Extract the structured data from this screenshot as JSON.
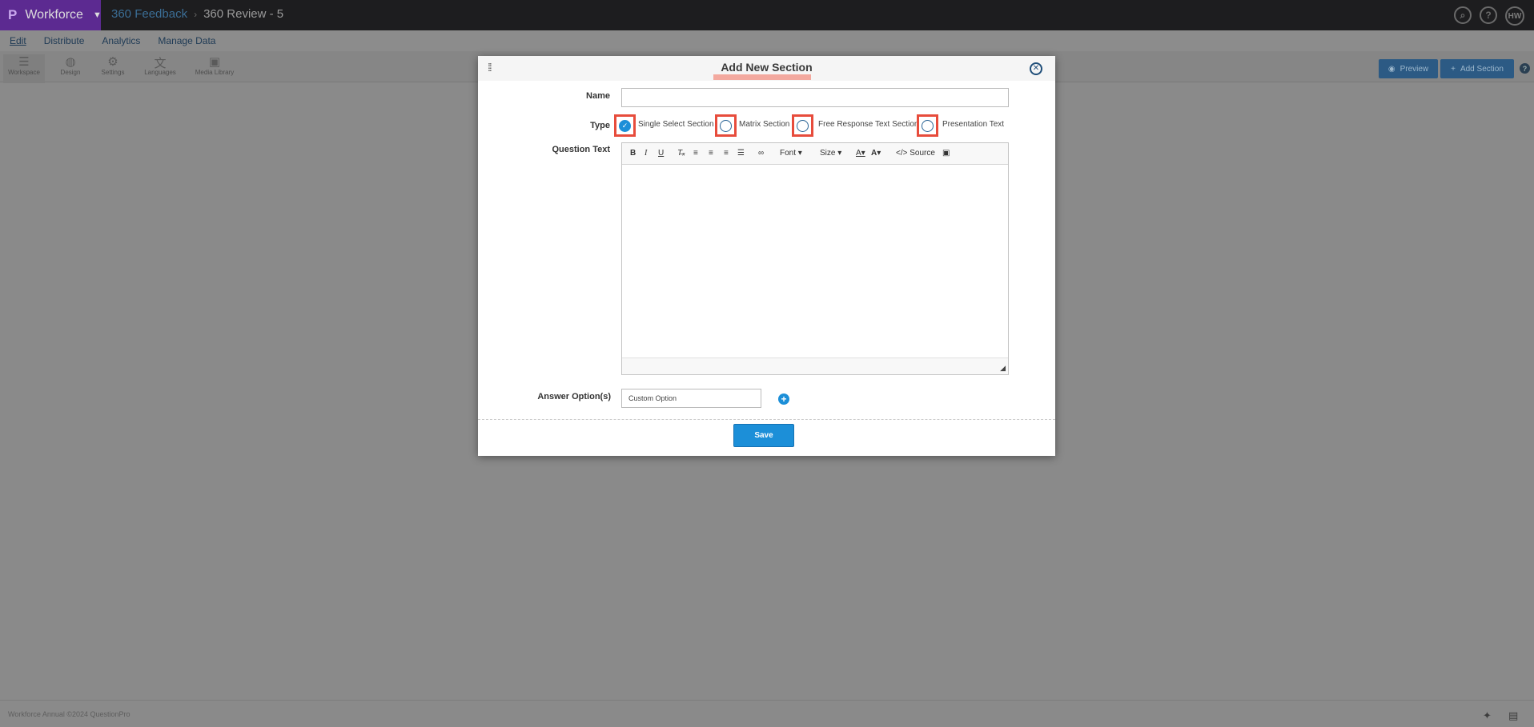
{
  "app": {
    "brand_logo": "P",
    "brand_name": "Workforce",
    "breadcrumb": [
      "360 Feedback",
      "360 Review - 5"
    ],
    "avatar_initials": "HW"
  },
  "menu": {
    "items": [
      "Edit",
      "Distribute",
      "Analytics",
      "Manage Data"
    ],
    "active": "Edit"
  },
  "toolbar": {
    "tools": [
      "Workspace",
      "Design",
      "Settings",
      "Languages",
      "Media Library"
    ],
    "preview_label": "Preview",
    "add_section_label": "Add Section"
  },
  "footer": {
    "text": "Workforce Annual ©2024 QuestionPro"
  },
  "modal": {
    "title": "Add New Section",
    "name_label": "Name",
    "name_value": "",
    "type_label": "Type",
    "types": [
      {
        "label": "Single Select Section",
        "checked": true
      },
      {
        "label": "Matrix Section",
        "checked": false
      },
      {
        "label": "Free Response Text Section",
        "checked": false
      },
      {
        "label": "Presentation Text",
        "checked": false
      }
    ],
    "question_text_label": "Question Text",
    "editor": {
      "font_label": "Font",
      "size_label": "Size",
      "source_label": "Source"
    },
    "answer_options_label": "Answer Option(s)",
    "answer_option_value": "Custom Option",
    "save_label": "Save"
  },
  "colors": {
    "accent": "#1c8fd8",
    "brand": "#5c2a91",
    "highlight": "#e74c3c"
  }
}
